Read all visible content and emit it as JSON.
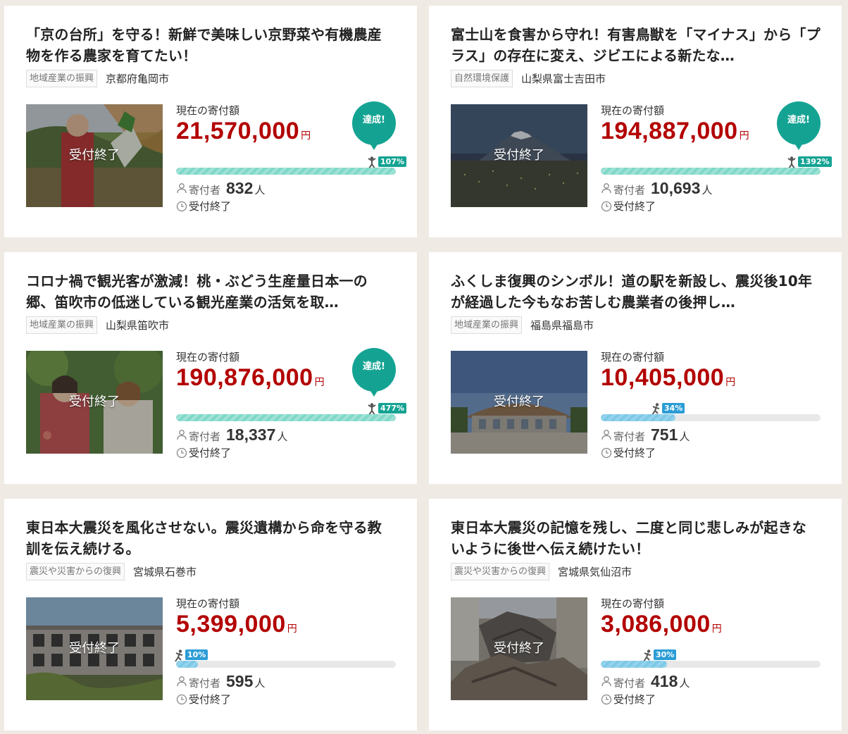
{
  "labels": {
    "current_amount": "現在の寄付額",
    "yen": "円",
    "donors": "寄付者",
    "person_unit": "人",
    "closed": "受付終了",
    "achieved": "達成!"
  },
  "projects": [
    {
      "title": "「京の台所」を守る！新鮮で美味しい京野菜や有機農産物を作る農家を育てたい！",
      "category": "地域産業の振興",
      "region": "京都府亀岡市",
      "amount": "21,570,000",
      "percent_label": "107%",
      "percent": 107,
      "donors": "832",
      "achieved": true,
      "thumb": "farmer-radish"
    },
    {
      "title": "富士山を食害から守れ！有害鳥獣を「マイナス」から「プラス」の存在に変え、ジビエによる新たな…",
      "category": "自然環境保護",
      "region": "山梨県富士吉田市",
      "amount": "194,887,000",
      "percent_label": "1392%",
      "percent": 1392,
      "donors": "10,693",
      "achieved": true,
      "thumb": "mount-fuji"
    },
    {
      "title": "コロナ禍で観光客が激減！桃・ぶどう生産量日本一の郷、笛吹市の低迷している観光産業の活気を取…",
      "category": "地域産業の振興",
      "region": "山梨県笛吹市",
      "amount": "190,876,000",
      "percent_label": "477%",
      "percent": 477,
      "donors": "18,337",
      "achieved": true,
      "thumb": "peach-orchard"
    },
    {
      "title": "ふくしま復興のシンボル！道の駅を新設し、震災後10年が経過した今もなお苦しむ農業者の後押し…",
      "category": "地域産業の振興",
      "region": "福島県福島市",
      "amount": "10,405,000",
      "percent_label": "34%",
      "percent": 34,
      "donors": "751",
      "achieved": false,
      "thumb": "roadside-station"
    },
    {
      "title": "東日本大震災を風化させない。震災遺構から命を守る教訓を伝え続ける。",
      "category": "震災や災害からの復興",
      "region": "宮城県石巻市",
      "amount": "5,399,000",
      "percent_label": "10%",
      "percent": 10,
      "donors": "595",
      "achieved": false,
      "thumb": "ruined-school"
    },
    {
      "title": "東日本大震災の記憶を残し、二度と同じ悲しみが起きないように後世へ伝え続けたい！",
      "category": "震災や災害からの復興",
      "region": "宮城県気仙沼市",
      "amount": "3,086,000",
      "percent_label": "30%",
      "percent": 30,
      "donors": "418",
      "achieved": false,
      "thumb": "tsunami-debris"
    }
  ],
  "colors": {
    "amount": "#b30000",
    "badge": "#14a393",
    "progress_achieved": "#7fd8c9",
    "progress_ongoing": "#7ec8e6",
    "percent_ongoing": "#2b9dd6"
  }
}
